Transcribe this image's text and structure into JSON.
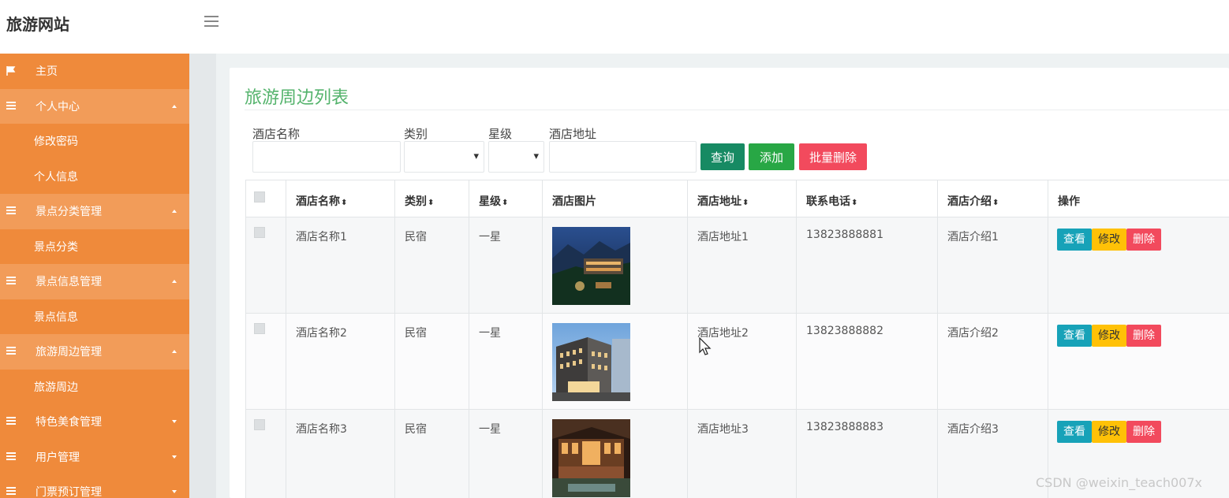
{
  "header": {
    "brand": "旅游网站"
  },
  "sidebar": {
    "items": [
      {
        "label": "主页",
        "type": "home",
        "icon": "flag-icon"
      },
      {
        "label": "个人中心",
        "type": "group",
        "open": true,
        "icon": "bars-icon"
      },
      {
        "label": "修改密码",
        "type": "sub"
      },
      {
        "label": "个人信息",
        "type": "sub"
      },
      {
        "label": "景点分类管理",
        "type": "group",
        "open": true,
        "icon": "bars-icon"
      },
      {
        "label": "景点分类",
        "type": "sub"
      },
      {
        "label": "景点信息管理",
        "type": "group",
        "open": true,
        "icon": "bars-icon"
      },
      {
        "label": "景点信息",
        "type": "sub"
      },
      {
        "label": "旅游周边管理",
        "type": "group",
        "open": true,
        "icon": "bars-icon"
      },
      {
        "label": "旅游周边",
        "type": "sub"
      },
      {
        "label": "特色美食管理",
        "type": "group",
        "open": false,
        "icon": "bars-icon"
      },
      {
        "label": "用户管理",
        "type": "group",
        "open": false,
        "icon": "bars-icon"
      },
      {
        "label": "门票预订管理",
        "type": "group",
        "open": false,
        "icon": "bars-icon"
      }
    ]
  },
  "main": {
    "title": "旅游周边列表",
    "filters": {
      "name_label": "酒店名称",
      "name_value": "",
      "category_label": "类别",
      "category_value": "",
      "stars_label": "星级",
      "stars_value": "",
      "address_label": "酒店地址",
      "address_value": ""
    },
    "buttons": {
      "query": "查询",
      "add": "添加",
      "batch_delete": "批量删除"
    },
    "table": {
      "columns": [
        "",
        "酒店名称",
        "类别",
        "星级",
        "酒店图片",
        "酒店地址",
        "联系电话",
        "酒店介绍",
        "操作"
      ],
      "sort_icon": "⬍",
      "rows": [
        {
          "name": "酒店名称1",
          "category": "民宿",
          "stars": "一星",
          "image": "night-valley-hotel",
          "address": "酒店地址1",
          "phone": "13823888881",
          "intro": "酒店介绍1"
        },
        {
          "name": "酒店名称2",
          "category": "民宿",
          "stars": "一星",
          "image": "city-hotel-building",
          "address": "酒店地址2",
          "phone": "13823888882",
          "intro": "酒店介绍2"
        },
        {
          "name": "酒店名称3",
          "category": "民宿",
          "stars": "一星",
          "image": "courtyard-hotel-night",
          "address": "酒店地址3",
          "phone": "13823888883",
          "intro": "酒店介绍3"
        }
      ],
      "actions": {
        "view": "查看",
        "edit": "修改",
        "delete": "删除"
      }
    }
  },
  "watermark": "CSDN @weixin_teach007x",
  "colors": {
    "sidebar": "#ef8a3b",
    "sidebar_group": "#f29c59",
    "title": "#54b36c",
    "view": "#17a2b8",
    "edit": "#ffc107",
    "delete": "#f24a5d",
    "query": "#178a63",
    "add": "#28a745"
  }
}
